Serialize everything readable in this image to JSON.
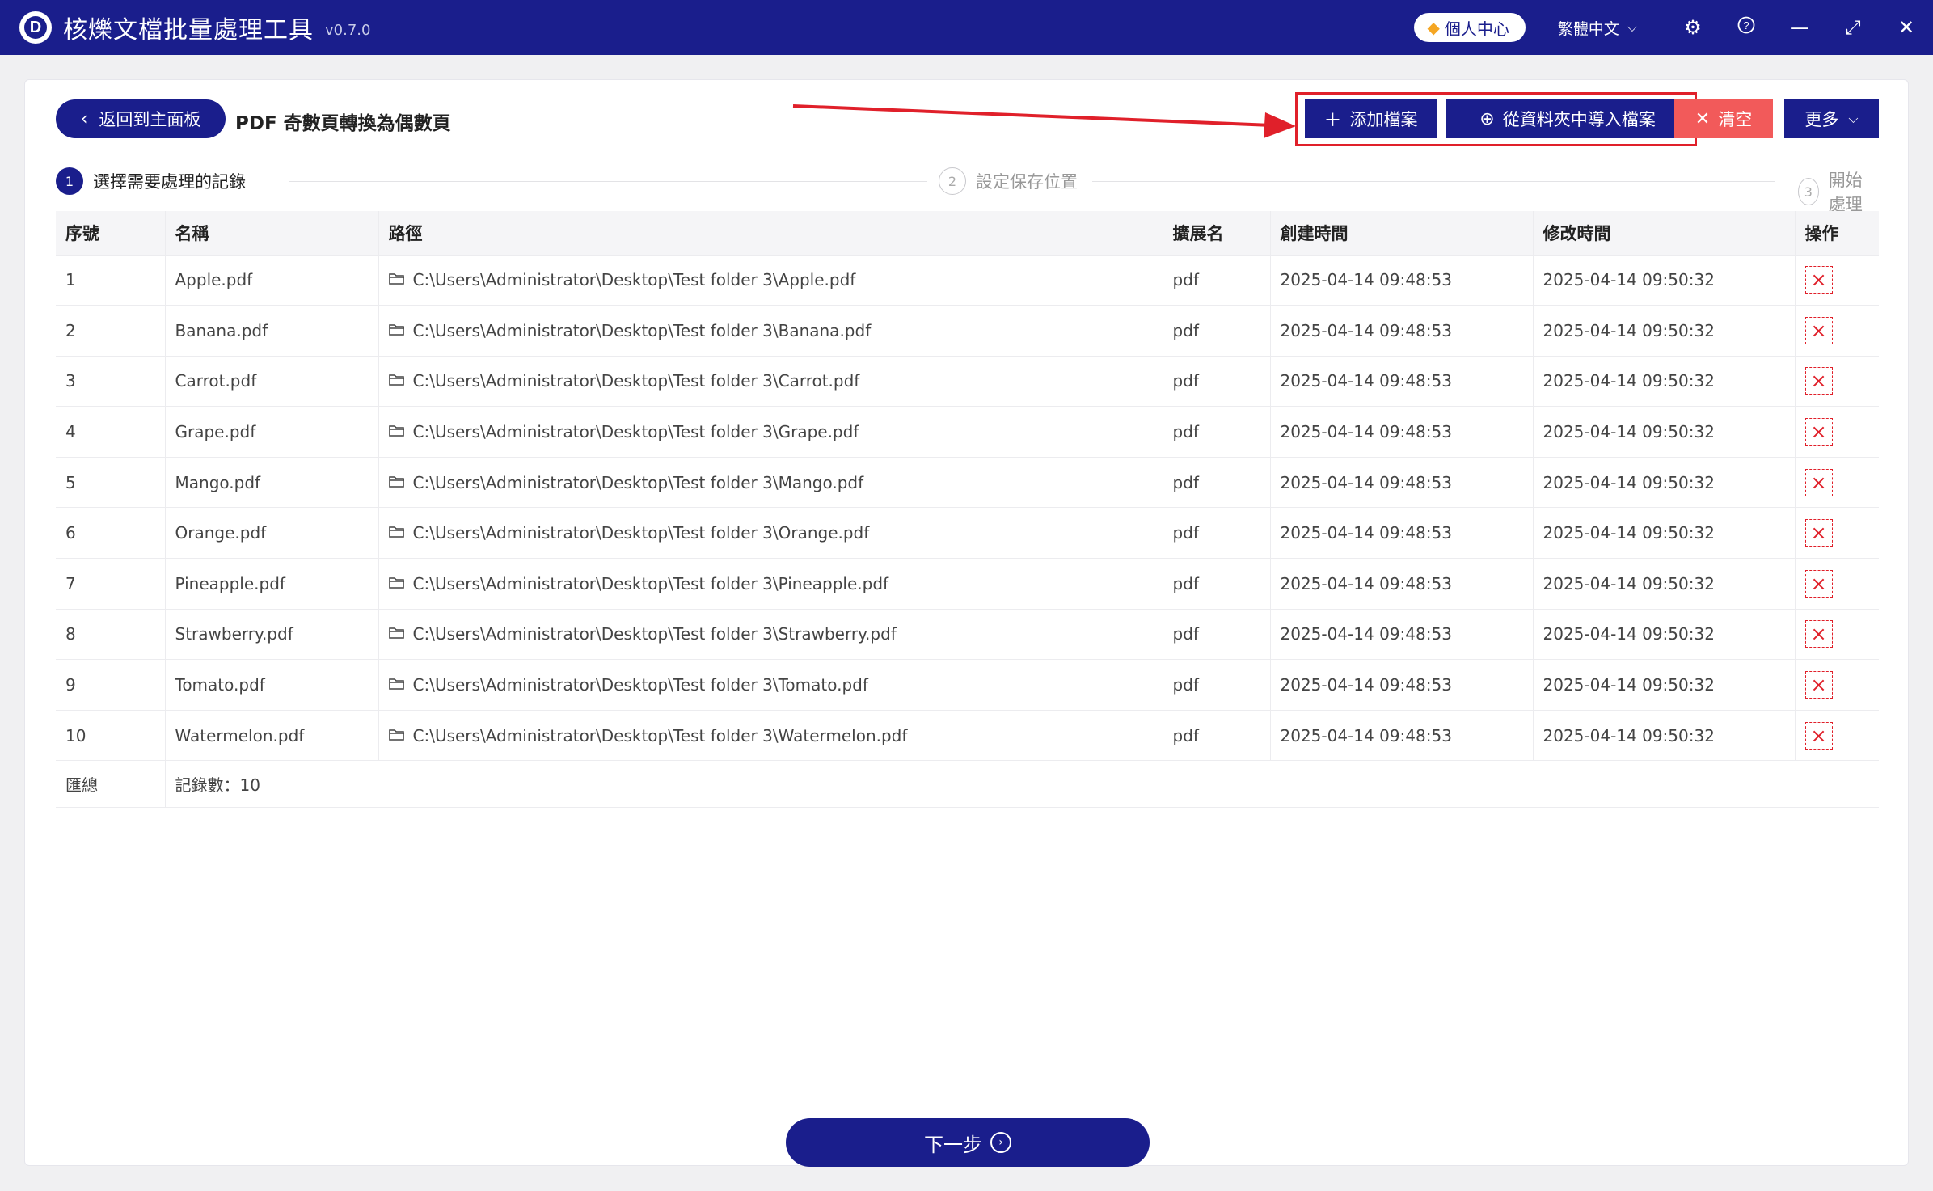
{
  "app": {
    "title": "核爍文檔批量處理工具",
    "version": "v0.7.0",
    "user_center": "個人中心",
    "language": "繁體中文"
  },
  "toolbar": {
    "back_label": "返回到主面板",
    "page_title": "PDF 奇數頁轉換為偶數頁",
    "add_label": "添加檔案",
    "import_label": "從資料夾中導入檔案",
    "clear_label": "清空",
    "more_label": "更多"
  },
  "steps": [
    {
      "num": "1",
      "label": "選擇需要處理的記錄"
    },
    {
      "num": "2",
      "label": "設定保存位置"
    },
    {
      "num": "3",
      "label": "開始處理"
    }
  ],
  "table": {
    "headers": [
      "序號",
      "名稱",
      "路徑",
      "擴展名",
      "創建時間",
      "修改時間",
      "操作"
    ],
    "rows": [
      {
        "idx": "1",
        "name": "Apple.pdf",
        "path": "C:\\Users\\Administrator\\Desktop\\Test folder 3\\Apple.pdf",
        "ext": "pdf",
        "created": "2025-04-14 09:48:53",
        "modified": "2025-04-14 09:50:32"
      },
      {
        "idx": "2",
        "name": "Banana.pdf",
        "path": "C:\\Users\\Administrator\\Desktop\\Test folder 3\\Banana.pdf",
        "ext": "pdf",
        "created": "2025-04-14 09:48:53",
        "modified": "2025-04-14 09:50:32"
      },
      {
        "idx": "3",
        "name": "Carrot.pdf",
        "path": "C:\\Users\\Administrator\\Desktop\\Test folder 3\\Carrot.pdf",
        "ext": "pdf",
        "created": "2025-04-14 09:48:53",
        "modified": "2025-04-14 09:50:32"
      },
      {
        "idx": "4",
        "name": "Grape.pdf",
        "path": "C:\\Users\\Administrator\\Desktop\\Test folder 3\\Grape.pdf",
        "ext": "pdf",
        "created": "2025-04-14 09:48:53",
        "modified": "2025-04-14 09:50:32"
      },
      {
        "idx": "5",
        "name": "Mango.pdf",
        "path": "C:\\Users\\Administrator\\Desktop\\Test folder 3\\Mango.pdf",
        "ext": "pdf",
        "created": "2025-04-14 09:48:53",
        "modified": "2025-04-14 09:50:32"
      },
      {
        "idx": "6",
        "name": "Orange.pdf",
        "path": "C:\\Users\\Administrator\\Desktop\\Test folder 3\\Orange.pdf",
        "ext": "pdf",
        "created": "2025-04-14 09:48:53",
        "modified": "2025-04-14 09:50:32"
      },
      {
        "idx": "7",
        "name": "Pineapple.pdf",
        "path": "C:\\Users\\Administrator\\Desktop\\Test folder 3\\Pineapple.pdf",
        "ext": "pdf",
        "created": "2025-04-14 09:48:53",
        "modified": "2025-04-14 09:50:32"
      },
      {
        "idx": "8",
        "name": "Strawberry.pdf",
        "path": "C:\\Users\\Administrator\\Desktop\\Test folder 3\\Strawberry.pdf",
        "ext": "pdf",
        "created": "2025-04-14 09:48:53",
        "modified": "2025-04-14 09:50:32"
      },
      {
        "idx": "9",
        "name": "Tomato.pdf",
        "path": "C:\\Users\\Administrator\\Desktop\\Test folder 3\\Tomato.pdf",
        "ext": "pdf",
        "created": "2025-04-14 09:48:53",
        "modified": "2025-04-14 09:50:32"
      },
      {
        "idx": "10",
        "name": "Watermelon.pdf",
        "path": "C:\\Users\\Administrator\\Desktop\\Test folder 3\\Watermelon.pdf",
        "ext": "pdf",
        "created": "2025-04-14 09:48:53",
        "modified": "2025-04-14 09:50:32"
      }
    ],
    "footer": {
      "summary_label": "匯總",
      "count_text": "記錄數：10"
    }
  },
  "next_label": "下一步",
  "colors": {
    "primary": "#1a1e8c",
    "danger": "#f25a5a",
    "highlight": "#e0202a"
  },
  "icons": {
    "logo": "logo-icon",
    "gem": "gem-icon",
    "settings": "gear-icon",
    "help": "help-icon",
    "minimize": "minimize-icon",
    "maximize": "maximize-icon",
    "close": "close-icon",
    "folder": "folder-icon",
    "delete": "delete-icon"
  }
}
